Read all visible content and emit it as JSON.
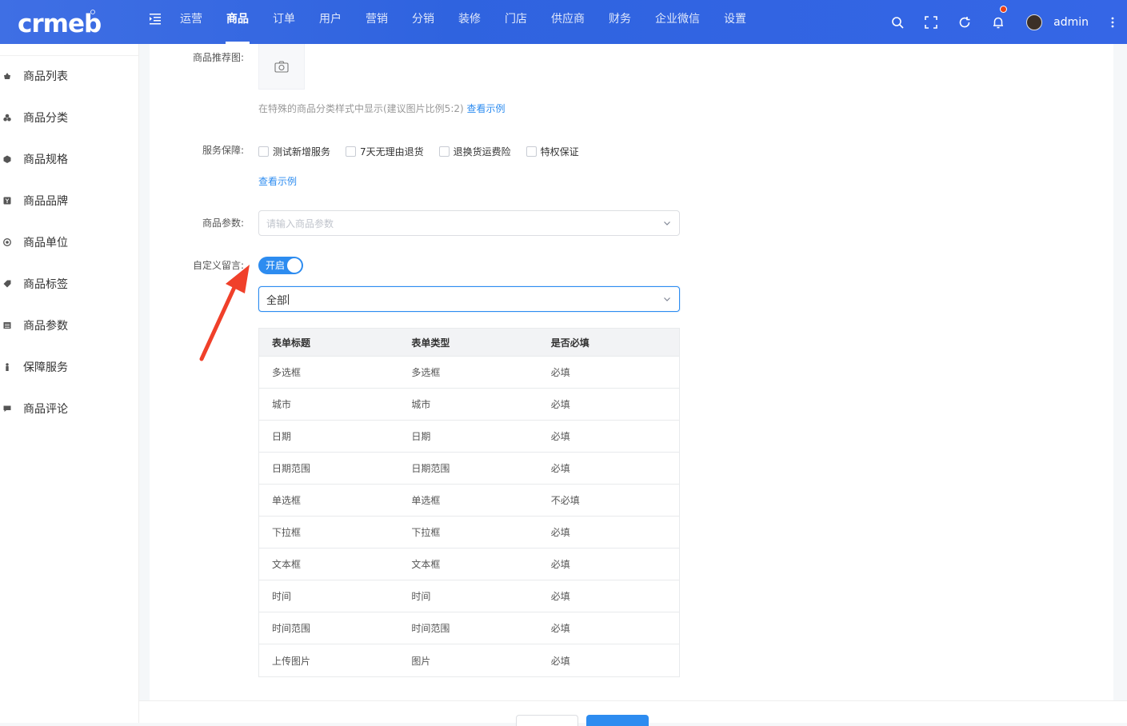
{
  "header": {
    "logo_text": "crmeb",
    "nav": [
      "运营",
      "商品",
      "订单",
      "用户",
      "营销",
      "分销",
      "装修",
      "门店",
      "供应商",
      "财务",
      "企业微信",
      "设置"
    ],
    "active_nav": "商品",
    "username": "admin"
  },
  "sidebar": {
    "items": [
      {
        "label": "商品列表",
        "icon": "basket-icon"
      },
      {
        "label": "商品分类",
        "icon": "cubes-icon"
      },
      {
        "label": "商品规格",
        "icon": "cube-icon"
      },
      {
        "label": "商品品牌",
        "icon": "brand-icon"
      },
      {
        "label": "商品单位",
        "icon": "unit-icon"
      },
      {
        "label": "商品标签",
        "icon": "tag-icon"
      },
      {
        "label": "商品参数",
        "icon": "list-icon"
      },
      {
        "label": "保障服务",
        "icon": "service-icon"
      },
      {
        "label": "商品评论",
        "icon": "comment-icon"
      }
    ]
  },
  "form": {
    "recommend_label": "商品推荐图:",
    "recommend_hint": "在特殊的商品分类样式中显示(建议图片比例5:2)",
    "view_example": "查看示例",
    "service_label": "服务保障:",
    "services": [
      "测试新增服务",
      "7天无理由退货",
      "退换货运费险",
      "特权保证"
    ],
    "service_example": "查看示例",
    "params_label": "商品参数:",
    "params_placeholder": "请输入商品参数",
    "custom_msg_label": "自定义留言:",
    "switch_label": "开启",
    "scope_value": "全部"
  },
  "table": {
    "headers": [
      "表单标题",
      "表单类型",
      "是否必填"
    ],
    "rows": [
      [
        "多选框",
        "多选框",
        "必填"
      ],
      [
        "城市",
        "城市",
        "必填"
      ],
      [
        "日期",
        "日期",
        "必填"
      ],
      [
        "日期范围",
        "日期范围",
        "必填"
      ],
      [
        "单选框",
        "单选框",
        "不必填"
      ],
      [
        "下拉框",
        "下拉框",
        "必填"
      ],
      [
        "文本框",
        "文本框",
        "必填"
      ],
      [
        "时间",
        "时间",
        "必填"
      ],
      [
        "时间范围",
        "时间范围",
        "必填"
      ],
      [
        "上传图片",
        "图片",
        "必填"
      ]
    ]
  },
  "colors": {
    "header": "#3366e2",
    "primary": "#2d8cf0",
    "arrow": "#f0402a"
  }
}
